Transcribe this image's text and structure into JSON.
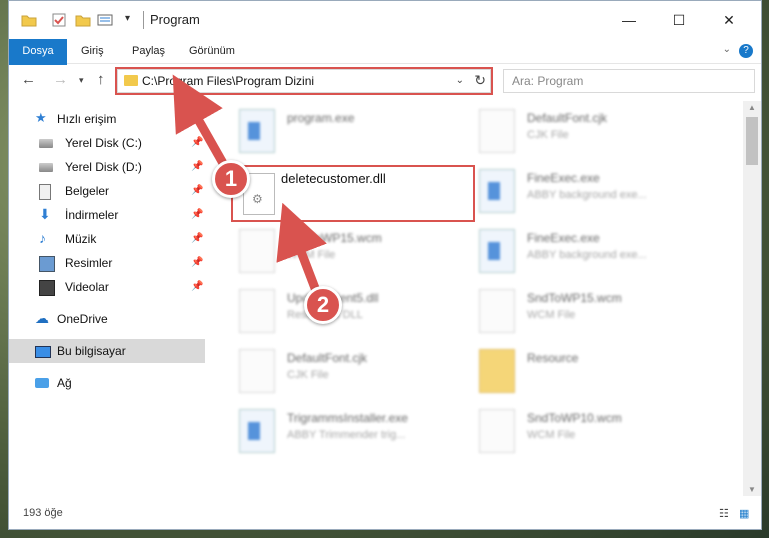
{
  "window": {
    "title": "Program"
  },
  "ribbon": {
    "tabs": [
      "Dosya",
      "Giriş",
      "Paylaş",
      "Görünüm"
    ]
  },
  "address": {
    "path": "C:\\Program Files\\Program Dizini"
  },
  "search": {
    "placeholder": "Ara: Program"
  },
  "sidebar": {
    "items": [
      {
        "label": "Hızlı erişim",
        "icon": "star-icon"
      },
      {
        "label": "Yerel Disk (C:)",
        "icon": "disk-icon"
      },
      {
        "label": "Yerel Disk (D:)",
        "icon": "disk-icon"
      },
      {
        "label": "Belgeler",
        "icon": "documents-icon"
      },
      {
        "label": "İndirmeler",
        "icon": "download-icon"
      },
      {
        "label": "Müzik",
        "icon": "music-icon"
      },
      {
        "label": "Resimler",
        "icon": "pictures-icon"
      },
      {
        "label": "Videolar",
        "icon": "videos-icon"
      },
      {
        "label": "OneDrive",
        "icon": "cloud-icon"
      },
      {
        "label": "Bu bilgisayar",
        "icon": "computer-icon"
      },
      {
        "label": "Ağ",
        "icon": "network-icon"
      }
    ]
  },
  "files": [
    {
      "name": "program.exe",
      "type": ""
    },
    {
      "name": "DefaultFont.cjk",
      "type": "CJK File"
    },
    {
      "name": "FineExec.exe",
      "type": "ABBY background exe..."
    },
    {
      "name": "SndToWP15.wcm",
      "type": "WCM File"
    },
    {
      "name": "FineExec.exe",
      "type": "ABBY background exe..."
    },
    {
      "name": "UpdateClient5.dll",
      "type": "Resources DLL"
    },
    {
      "name": "SndToWP15.wcm",
      "type": "WCM File"
    },
    {
      "name": "DefaultFont.cjk",
      "type": "CJK File"
    },
    {
      "name": "Resource",
      "type": ""
    },
    {
      "name": "TrigrammsInstaller.exe",
      "type": "ABBY Trimmender trig..."
    },
    {
      "name": "SndToWP10.wcm",
      "type": "WCM File"
    }
  ],
  "highlighted_file": {
    "name": "deletecustomer.dll"
  },
  "annotations": {
    "step1": "1",
    "step2": "2"
  },
  "status": {
    "count": "193 öğe"
  },
  "colors": {
    "accent": "#1979ca",
    "highlight": "#d9534f"
  }
}
